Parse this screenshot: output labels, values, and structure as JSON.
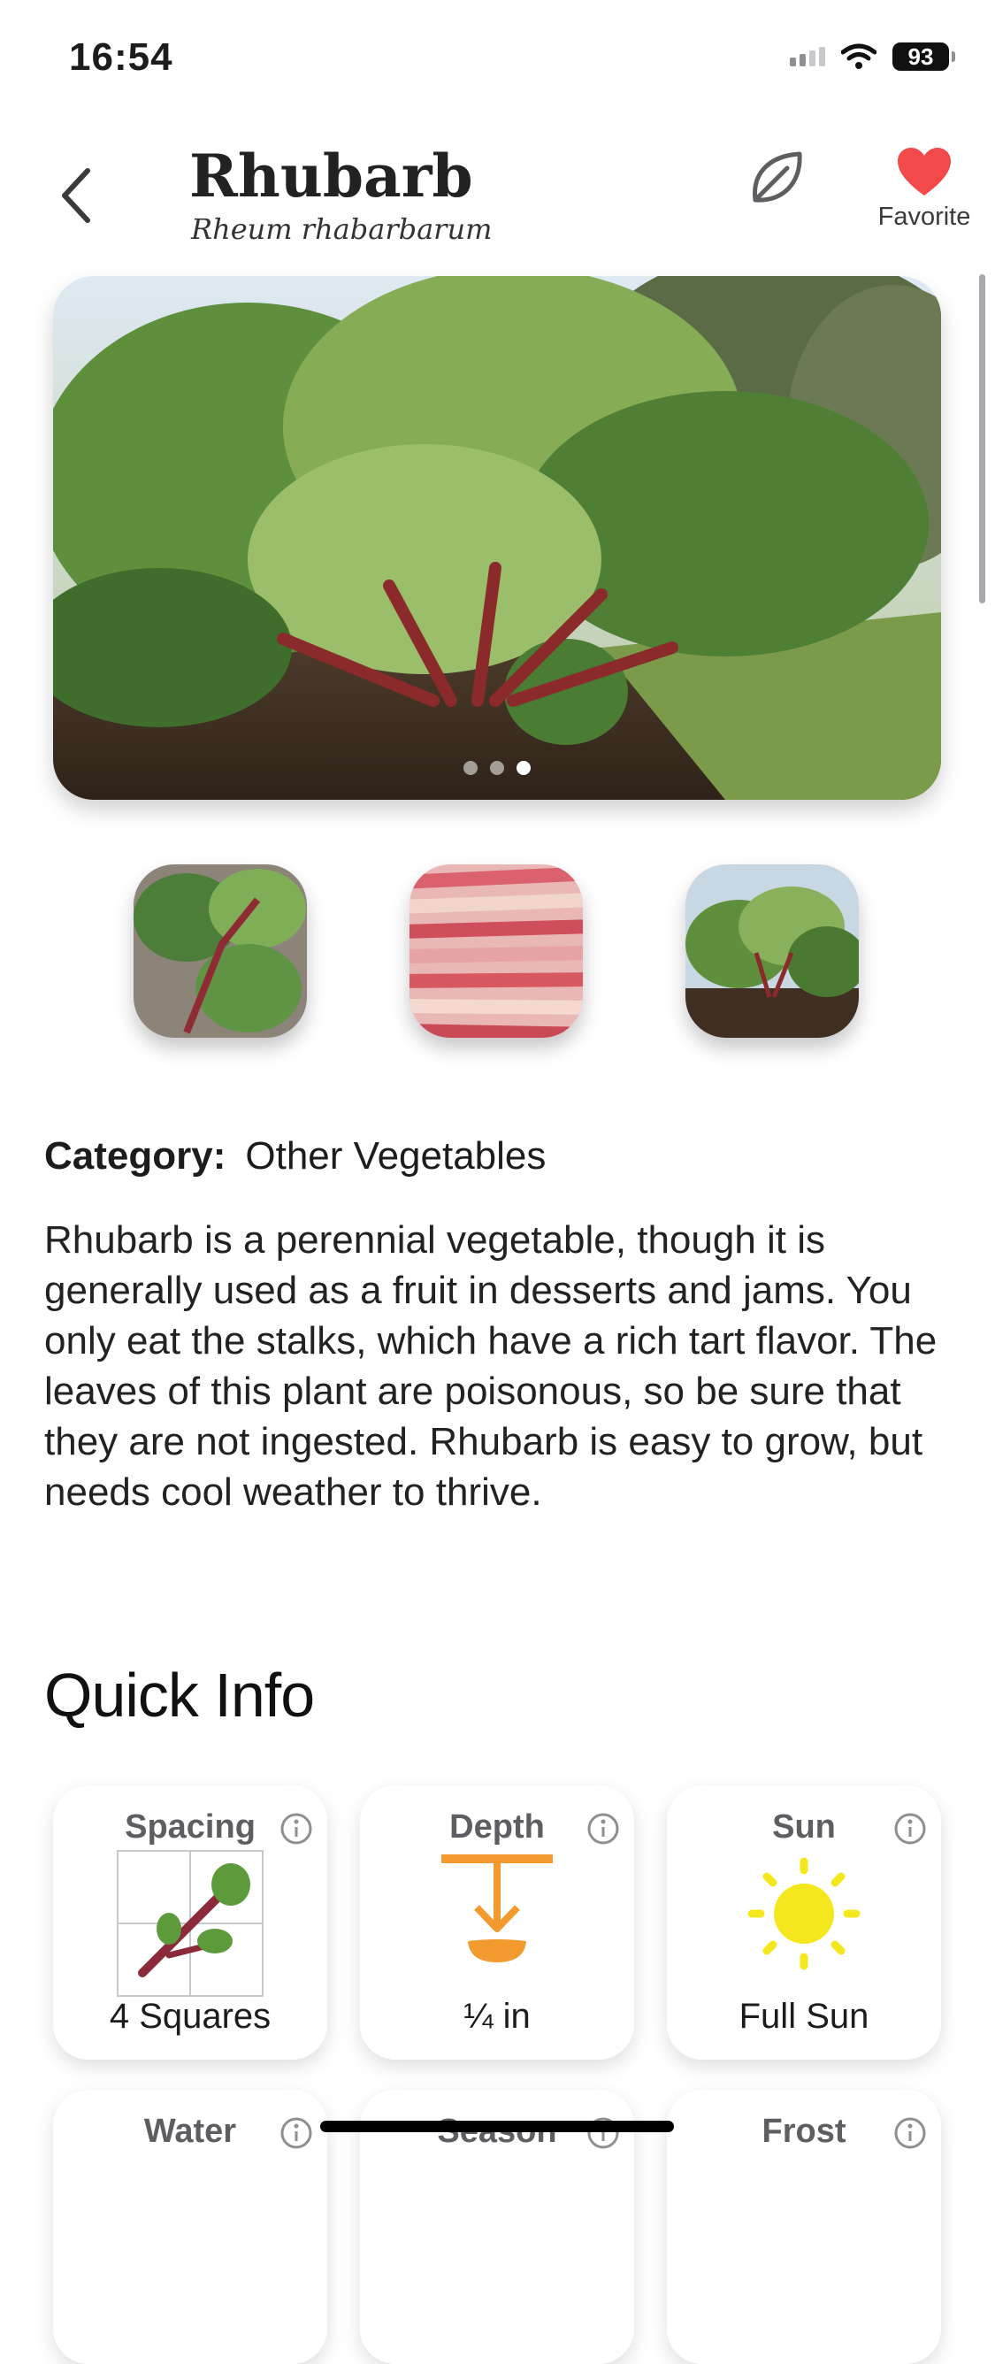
{
  "status_bar": {
    "time": "16:54",
    "battery": "93"
  },
  "header": {
    "title": "Rhubarb",
    "subtitle": "Rheum rhabarbarum",
    "favorite_label": "Favorite"
  },
  "gallery": {
    "dot_count": 3,
    "active_index": 2
  },
  "details": {
    "category_label": "Category:",
    "category_value": "Other Vegetables",
    "description": "Rhubarb is a perennial vegetable, though it is generally used as a fruit in desserts and jams. You only eat the stalks, which have a rich tart flavor. The leaves of this plant are poisonous, so be sure that they are not ingested. Rhubarb is easy to grow, but needs cool weather to thrive."
  },
  "quick_info": {
    "title": "Quick Info",
    "cards": [
      {
        "label": "Spacing",
        "value": "4 Squares"
      },
      {
        "label": "Depth",
        "value": "¼ in"
      },
      {
        "label": "Sun",
        "value": "Full Sun"
      },
      {
        "label": "Water",
        "value": ""
      },
      {
        "label": "Season",
        "value": ""
      },
      {
        "label": "Frost",
        "value": ""
      }
    ]
  },
  "colors": {
    "favorite": "#f24a4a",
    "depth_icon": "#f29a2e",
    "sun_icon": "#f5e71e"
  }
}
